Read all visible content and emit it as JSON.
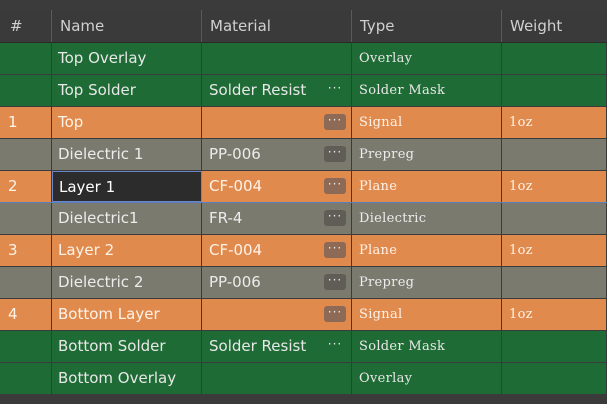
{
  "table": {
    "columns": [
      "#",
      "Name",
      "Material",
      "Type",
      "Weight"
    ],
    "more_glyph": "···",
    "rows": [
      {
        "num": "",
        "name": "Top Overlay",
        "material": "",
        "type": "Overlay",
        "weight": "",
        "color": "green",
        "more": false
      },
      {
        "num": "",
        "name": "Top Solder",
        "material": "Solder Resist",
        "type": "Solder Mask",
        "weight": "",
        "color": "green",
        "more": true
      },
      {
        "num": "1",
        "name": "Top",
        "material": "",
        "type": "Signal",
        "weight": "1oz",
        "color": "orange",
        "more": true
      },
      {
        "num": "",
        "name": "Dielectric 1",
        "material": "PP-006",
        "type": "Prepreg",
        "weight": "",
        "color": "gray",
        "more": true
      },
      {
        "num": "2",
        "name": "Layer 1",
        "material": "CF-004",
        "type": "Plane",
        "weight": "1oz",
        "color": "orange",
        "more": true,
        "selected": true
      },
      {
        "num": "",
        "name": "Dielectric1",
        "material": "FR-4",
        "type": "Dielectric",
        "weight": "",
        "color": "gray",
        "more": true
      },
      {
        "num": "3",
        "name": "Layer 2",
        "material": "CF-004",
        "type": "Plane",
        "weight": "1oz",
        "color": "orange",
        "more": true
      },
      {
        "num": "",
        "name": "Dielectric 2",
        "material": "PP-006",
        "type": "Prepreg",
        "weight": "",
        "color": "gray",
        "more": true
      },
      {
        "num": "4",
        "name": "Bottom Layer",
        "material": "",
        "type": "Signal",
        "weight": "1oz",
        "color": "orange",
        "more": true
      },
      {
        "num": "",
        "name": "Bottom Solder",
        "material": "Solder Resist",
        "type": "Solder Mask",
        "weight": "",
        "color": "green",
        "more": true
      },
      {
        "num": "",
        "name": "Bottom Overlay",
        "material": "",
        "type": "Overlay",
        "weight": "",
        "color": "green",
        "more": false
      }
    ]
  },
  "colors": {
    "signal_layer": "#e08a4e",
    "dielectric_layer": "#7b7a6f",
    "mask_overlay_layer": "#1e6b35"
  }
}
